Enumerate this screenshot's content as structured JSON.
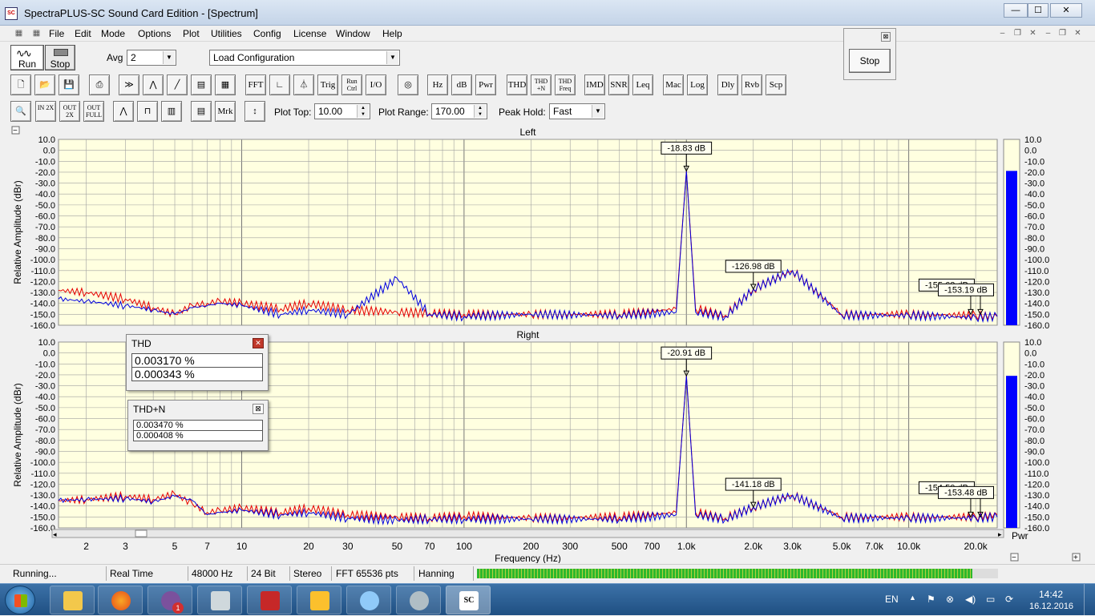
{
  "window": {
    "title": "SpectraPLUS-SC Sound Card Edition - [Spectrum]",
    "app_icon": "SC",
    "min": "—",
    "max": "☐",
    "close": "✕"
  },
  "menu": [
    "File",
    "Edit",
    "Mode",
    "Options",
    "Plot",
    "Utilities",
    "Config",
    "License",
    "Window",
    "Help"
  ],
  "toolbar1": {
    "run_label": "Run",
    "stop_label": "Stop",
    "avg_label": "Avg",
    "avg_value": "2",
    "config_value": "Load Configuration"
  },
  "stop_panel": {
    "label": "Stop"
  },
  "toolbar2": [
    "FFT",
    "Trig",
    "Run Ctrl",
    "I/O",
    "Hz",
    "dB",
    "Pwr",
    "THD",
    "THD +N",
    "THD Freq",
    "IMD",
    "SNR",
    "Leq",
    "Mac",
    "Log",
    "Dly",
    "Rvb",
    "Scp"
  ],
  "toolbar3": {
    "zoom_in_2x": "IN 2X",
    "zoom_out_2x": "OUT 2X",
    "zoom_out_full": "OUT FULL",
    "mrk": "Mrk",
    "plot_top_label": "Plot Top:",
    "plot_top_value": "10.00",
    "plot_range_label": "Plot Range:",
    "plot_range_value": "170.00",
    "peak_hold_label": "Peak Hold:",
    "peak_hold_value": "Fast"
  },
  "colors": {
    "plot_bg": "#ffffe0",
    "trace_red": "#e60000",
    "trace_blue": "#0000e0",
    "bar_blue": "#0000ff",
    "grid": "#a0a0a0"
  },
  "chart_data": [
    {
      "type": "line",
      "title": "Left",
      "ylabel": "Relative Amplitude (dBr)",
      "xlabel": "",
      "xscale": "log",
      "xlim": [
        1.5,
        25000
      ],
      "ylim": [
        -160,
        10
      ],
      "yticks": [
        "10.0",
        "0.0",
        "-10.0",
        "-20.0",
        "-30.0",
        "-40.0",
        "-50.0",
        "-60.0",
        "-70.0",
        "-80.0",
        "-90.0",
        "-100.0",
        "-110.0",
        "-120.0",
        "-130.0",
        "-140.0",
        "-150.0",
        "-160.0"
      ],
      "grid": true,
      "series": [
        {
          "color": "#e60000",
          "x": [
            1.5,
            2,
            3,
            4,
            5,
            6,
            7,
            8,
            10,
            15,
            20,
            30,
            50,
            70,
            100,
            200,
            500,
            900,
            1000,
            1100,
            1500,
            2000,
            3000,
            5000,
            10000,
            20000,
            25000
          ],
          "y": [
            -128,
            -130,
            -136,
            -144,
            -150,
            -142,
            -140,
            -138,
            -140,
            -145,
            -140,
            -146,
            -148,
            -149,
            -150,
            -150,
            -150,
            -145,
            -18.83,
            -145,
            -151,
            -127,
            -110,
            -150,
            -150,
            -151,
            -152
          ]
        },
        {
          "color": "#0000e0",
          "x": [
            1.5,
            2,
            3,
            4,
            5,
            6,
            7,
            8,
            10,
            15,
            20,
            30,
            50,
            70,
            100,
            200,
            500,
            900,
            1000,
            1100,
            1500,
            2000,
            3000,
            5000,
            10000,
            20000,
            25000
          ],
          "y": [
            -136,
            -138,
            -142,
            -146,
            -150,
            -144,
            -142,
            -140,
            -142,
            -150,
            -146,
            -150,
            -117,
            -150,
            -152,
            -150,
            -151,
            -148,
            -18.83,
            -148,
            -152,
            -127,
            -110,
            -151,
            -151,
            -153,
            -152
          ]
        }
      ],
      "markers": [
        {
          "x": 1000,
          "label": "-18.83 dB"
        },
        {
          "x": 2000,
          "label": "-126.98 dB"
        },
        {
          "x": 19000,
          "label": "-155.63 dB"
        },
        {
          "x": 21000,
          "label": "-153.19 dB"
        }
      ],
      "level_bar": {
        "value": -18.83,
        "labels": [
          "10.0",
          "0.0",
          "-10.0",
          "-20.0",
          "-30.0",
          "-40.0",
          "-50.0",
          "-60.0",
          "-70.0",
          "-80.0",
          "-90.0",
          "-100.0",
          "-110.0",
          "-120.0",
          "-130.0",
          "-140.0",
          "-150.0",
          "-160.0"
        ]
      }
    },
    {
      "type": "line",
      "title": "Right",
      "ylabel": "Relative Amplitude (dBr)",
      "xlabel": "Frequency (Hz)",
      "xscale": "log",
      "xlim": [
        1.5,
        25000
      ],
      "ylim": [
        -160,
        10
      ],
      "xticks": [
        "2",
        "3",
        "5",
        "7",
        "10",
        "20",
        "30",
        "50",
        "70",
        "100",
        "200",
        "300",
        "500",
        "700",
        "1.0k",
        "2.0k",
        "3.0k",
        "5.0k",
        "7.0k",
        "10.0k",
        "20.0k"
      ],
      "xtick_values": [
        2,
        3,
        5,
        7,
        10,
        20,
        30,
        50,
        70,
        100,
        200,
        300,
        500,
        700,
        1000,
        2000,
        3000,
        5000,
        7000,
        10000,
        20000
      ],
      "yticks": [
        "10.0",
        "0.0",
        "-10.0",
        "-20.0",
        "-30.0",
        "-40.0",
        "-50.0",
        "-60.0",
        "-70.0",
        "-80.0",
        "-90.0",
        "-100.0",
        "-110.0",
        "-120.0",
        "-130.0",
        "-140.0",
        "-150.0",
        "-160.0"
      ],
      "grid": true,
      "series": [
        {
          "color": "#e60000",
          "x": [
            1.5,
            2,
            3,
            4,
            5,
            6,
            7,
            8,
            10,
            15,
            20,
            30,
            50,
            70,
            100,
            200,
            500,
            900,
            1000,
            1100,
            1500,
            2000,
            3000,
            5000,
            10000,
            20000,
            25000
          ],
          "y": [
            -135,
            -134,
            -131,
            -134,
            -129,
            -138,
            -146,
            -144,
            -142,
            -146,
            -142,
            -148,
            -150,
            -151,
            -149,
            -151,
            -150,
            -146,
            -20.91,
            -146,
            -151,
            -141,
            -130,
            -150,
            -150,
            -150,
            -148
          ]
        },
        {
          "color": "#0000e0",
          "x": [
            1.5,
            2,
            3,
            4,
            5,
            6,
            7,
            8,
            10,
            15,
            20,
            30,
            50,
            70,
            100,
            200,
            500,
            900,
            1000,
            1100,
            1500,
            2000,
            3000,
            5000,
            10000,
            20000,
            25000
          ],
          "y": [
            -135,
            -134,
            -133,
            -136,
            -131,
            -135,
            -148,
            -146,
            -144,
            -148,
            -146,
            -151,
            -153,
            -152,
            -152,
            -152,
            -152,
            -148,
            -20.91,
            -148,
            -152,
            -141,
            -130,
            -151,
            -151,
            -151,
            -150
          ]
        }
      ],
      "markers": [
        {
          "x": 1000,
          "label": "-20.91 dB"
        },
        {
          "x": 2000,
          "label": "-141.18 dB"
        },
        {
          "x": 19000,
          "label": "-154.50 dB"
        },
        {
          "x": 21000,
          "label": "-153.48 dB"
        }
      ],
      "level_bar": {
        "value": -20.91,
        "labels": [
          "10.0",
          "0.0",
          "-10.0",
          "-20.0",
          "-30.0",
          "-40.0",
          "-50.0",
          "-60.0",
          "-70.0",
          "-80.0",
          "-90.0",
          "-100.0",
          "-110.0",
          "-120.0",
          "-130.0",
          "-140.0",
          "-150.0",
          "-160.0"
        ],
        "unit": "Pwr"
      }
    }
  ],
  "thd_window": {
    "title": "THD",
    "values": [
      "0.003170 %",
      "0.000343 %"
    ]
  },
  "thdn_window": {
    "title": "THD+N",
    "values": [
      "0.003470 %",
      "0.000408 %"
    ]
  },
  "status": {
    "state": "Running...",
    "mode": "Real Time",
    "rate": "48000 Hz",
    "bits": "24 Bit",
    "channels": "Stereo",
    "fft": "FFT 65536 pts",
    "window": "Hanning",
    "level_fraction": 0.95
  },
  "taskbar": {
    "lang": "EN",
    "time": "14:42",
    "date": "16.12.2016",
    "badge": "1"
  }
}
